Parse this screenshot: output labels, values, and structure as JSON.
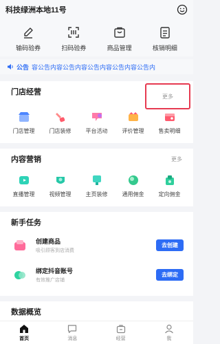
{
  "header": {
    "store_name": "科技绿洲本地11号"
  },
  "quick_actions": [
    {
      "label": "输码验券",
      "icon": "pen-icon"
    },
    {
      "label": "扫码验券",
      "icon": "scan-icon"
    },
    {
      "label": "商品管理",
      "icon": "bag-icon"
    },
    {
      "label": "核销明细",
      "icon": "list-icon"
    }
  ],
  "notice": {
    "title": "公告",
    "text": "容公告内容公告内容公告内容公告内容公告内"
  },
  "store_ops": {
    "title": "门店经营",
    "more": "更多",
    "items": [
      {
        "label": "门店管理",
        "icon": "store-icon"
      },
      {
        "label": "门店装修",
        "icon": "decorate-icon"
      },
      {
        "label": "平台活动",
        "icon": "activity-icon"
      },
      {
        "label": "评价管理",
        "icon": "review-icon"
      },
      {
        "label": "售卖明细",
        "icon": "sales-icon"
      }
    ]
  },
  "content_marketing": {
    "title": "内容营销",
    "more": "更多",
    "items": [
      {
        "label": "直播管理",
        "icon": "live-icon"
      },
      {
        "label": "视频管理",
        "icon": "video-icon"
      },
      {
        "label": "主页装修",
        "icon": "homepage-icon"
      },
      {
        "label": "通用佣金",
        "icon": "commission-icon"
      },
      {
        "label": "定向佣金",
        "icon": "target-commission-icon"
      }
    ]
  },
  "newbie_tasks": {
    "title": "新手任务",
    "tasks": [
      {
        "title": "创建商品",
        "subtitle": "吸引顾客到店消费",
        "button": "去创建"
      },
      {
        "title": "绑定抖音账号",
        "subtitle": "有效推广店铺",
        "button": "去绑定"
      }
    ]
  },
  "data_overview": {
    "title": "数据概览"
  },
  "bottom_nav": [
    {
      "label": "首页",
      "icon": "home-icon",
      "active": true
    },
    {
      "label": "消息",
      "icon": "message-icon",
      "active": false
    },
    {
      "label": "经营",
      "icon": "briefcase-icon",
      "active": false
    },
    {
      "label": "我",
      "icon": "person-icon",
      "active": false
    }
  ],
  "colors": {
    "accent": "#2d6cf5",
    "highlight": "#e63950"
  }
}
